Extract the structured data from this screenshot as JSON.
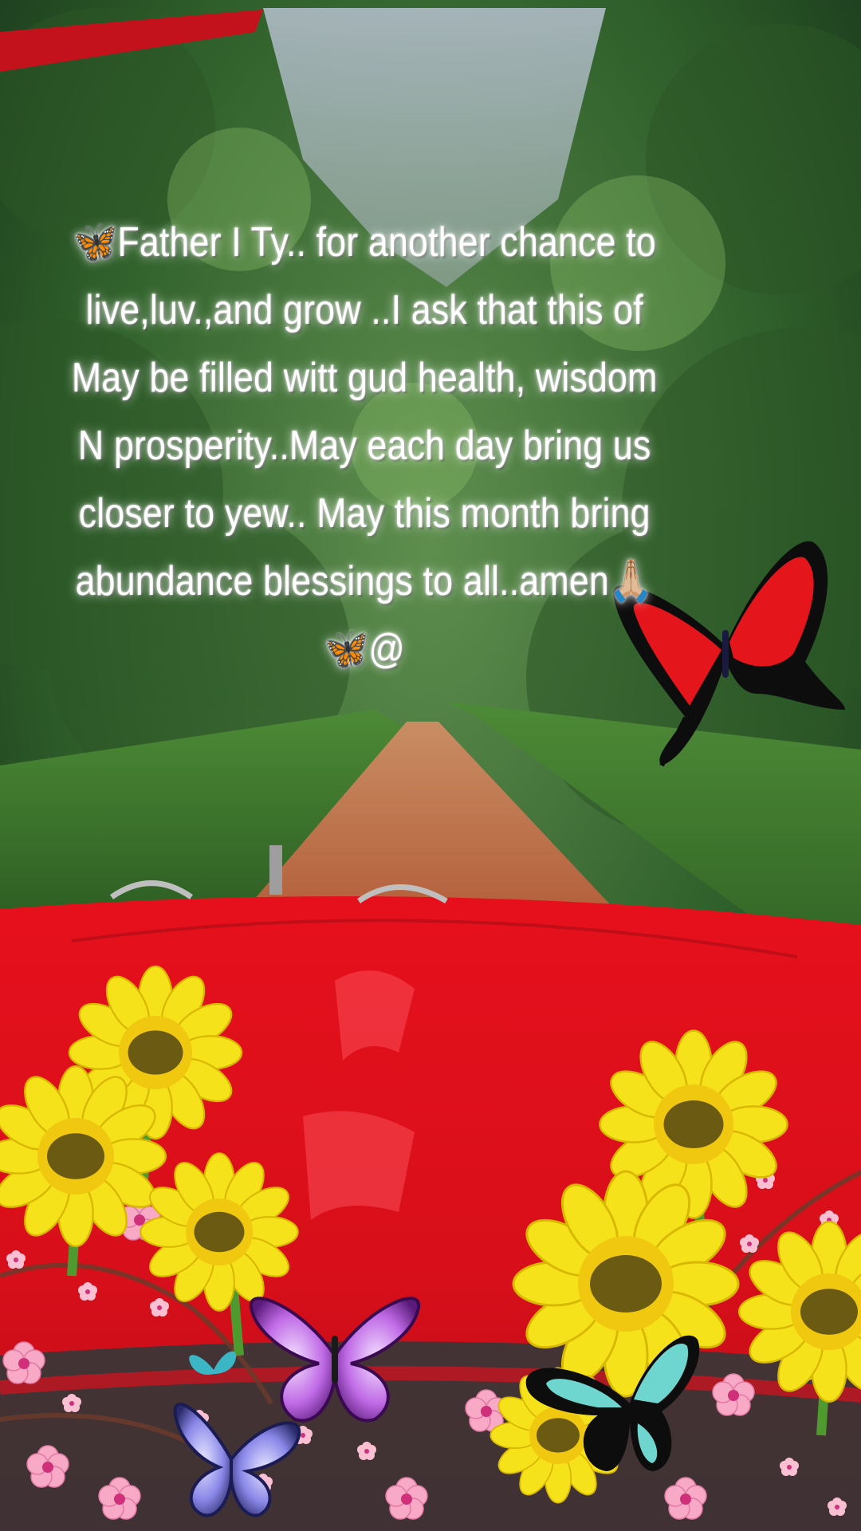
{
  "caption": {
    "lines": [
      "🦋Father I Ty.. for  another chance to",
      "live,luv.,and grow ..I ask that this  of",
      "May be filled witt gud health, wisdom",
      "N prosperity..May each day bring us",
      "closer to yew.. May this month bring",
      "abundance blessings to all..amen🙏🏼",
      "🦋@"
    ]
  },
  "scene": {
    "background": "forest dirt road viewed over red car hood",
    "decorations": [
      "red-butterfly",
      "sunflowers",
      "cherry-blossoms",
      "purple-butterfly",
      "teal-butterfly",
      "blue-butterfly"
    ]
  },
  "colors": {
    "hood_red": "#e0141f",
    "foliage_green": "#3f7a33",
    "road_brown": "#b8673f",
    "sunflower_yellow": "#f6e21a",
    "blossom_pink": "#f7a9c6"
  }
}
